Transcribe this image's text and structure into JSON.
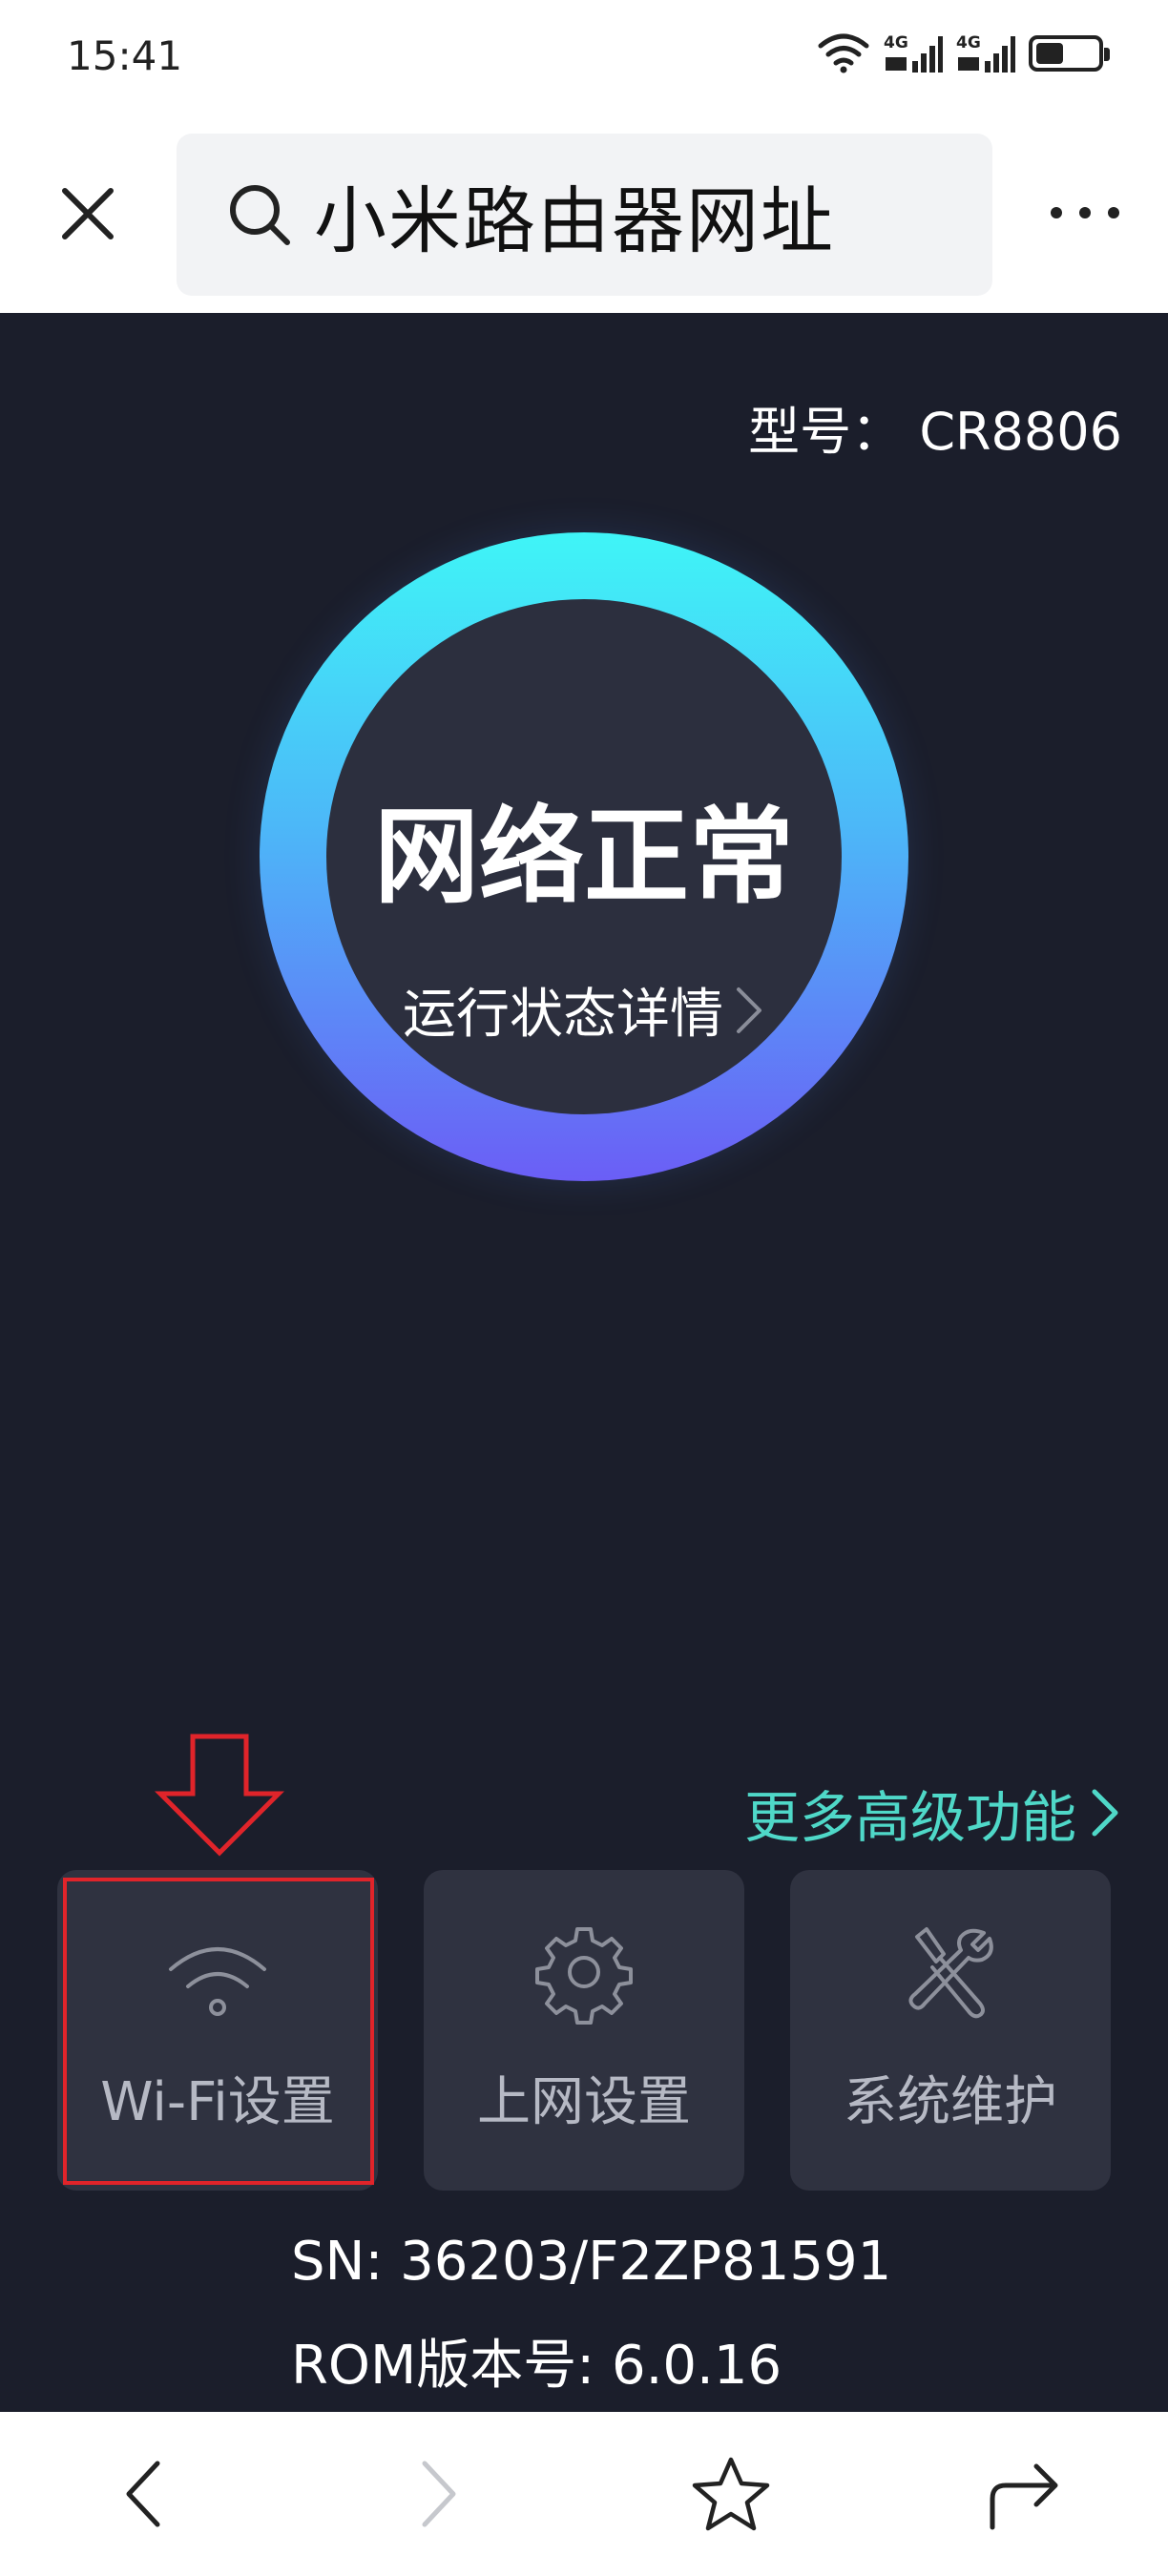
{
  "status_bar": {
    "time": "15:41",
    "icons": [
      "wifi-icon",
      "signal-4g-icon",
      "signal-4g-icon",
      "battery-icon"
    ],
    "signal_label": "4G",
    "battery_level": 0.45
  },
  "browser": {
    "search_text": "小米路由器网址",
    "icons": {
      "close": "close-icon",
      "search": "search-icon",
      "more": "more-icon"
    }
  },
  "router": {
    "model": "型号：  CR8806",
    "status_title": "网络正常",
    "status_link": "运行状态详情",
    "advanced_link": "更多高级功能",
    "cards": [
      {
        "label": "Wi-Fi设置",
        "icon": "wifi-icon"
      },
      {
        "label": "上网设置",
        "icon": "gear-icon"
      },
      {
        "label": "系统维护",
        "icon": "tools-icon"
      }
    ],
    "sn": "SN:  36203/F2ZP81591",
    "rom": "ROM版本号:  6.0.16",
    "colors": {
      "background": "#1b1e2b",
      "ring_top": "#3ff5f7",
      "ring_bottom": "#6b5ef6",
      "accent": "#4fd8c8",
      "highlight": "#e0242a"
    }
  },
  "bottom_nav": {
    "icons": [
      "back-icon",
      "forward-icon",
      "star-icon",
      "share-icon"
    ]
  }
}
